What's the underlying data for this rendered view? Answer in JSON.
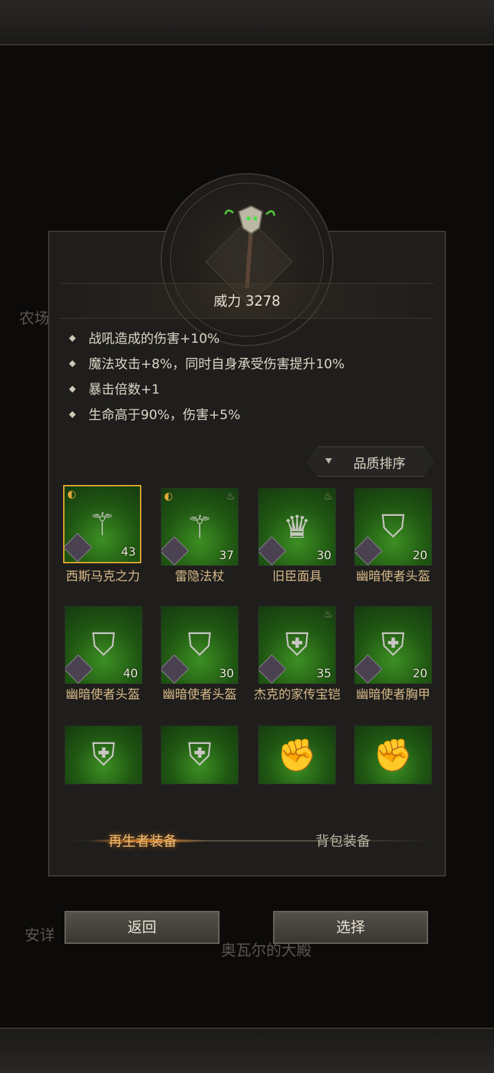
{
  "background": {
    "left_label_1": "农场",
    "left_label_2": "安详",
    "bottom_label": "奥瓦尔的大殿"
  },
  "detail": {
    "power": "威力 3278",
    "attributes": [
      "战吼造成的伤害+10%",
      "魔法攻击+8%，同时自身承受伤害提升10%",
      "暴击倍数+1",
      "生命高于90%，伤害+5%"
    ]
  },
  "sort": {
    "label": "品质排序"
  },
  "items": [
    {
      "name": "西斯马克之力",
      "level": "43",
      "icon": "staff-icon",
      "selected": true
    },
    {
      "name": "雷隐法杖",
      "level": "37",
      "icon": "staff-icon"
    },
    {
      "name": "旧臣面具",
      "level": "30",
      "icon": "mask-icon"
    },
    {
      "name": "幽暗使者头盔",
      "level": "20",
      "icon": "helmet-icon"
    },
    {
      "name": "幽暗使者头盔",
      "level": "40",
      "icon": "helmet-icon"
    },
    {
      "name": "幽暗使者头盔",
      "level": "30",
      "icon": "helmet-icon"
    },
    {
      "name": "杰克的家传宝铠",
      "level": "35",
      "icon": "armor-icon"
    },
    {
      "name": "幽暗使者胸甲",
      "level": "20",
      "icon": "chestplate-icon"
    },
    {
      "icon": "chestplate-icon"
    },
    {
      "icon": "chestplate-icon"
    },
    {
      "icon": "gauntlet-icon"
    },
    {
      "icon": "gauntlet-icon"
    }
  ],
  "tabs": {
    "active": "再生者装备",
    "other": "背包装备"
  },
  "buttons": {
    "back": "返回",
    "select": "选择"
  },
  "colors": {
    "accent_gold": "#e0a82e",
    "item_green": "#3c8f22",
    "name_text": "#d8ba8a"
  }
}
